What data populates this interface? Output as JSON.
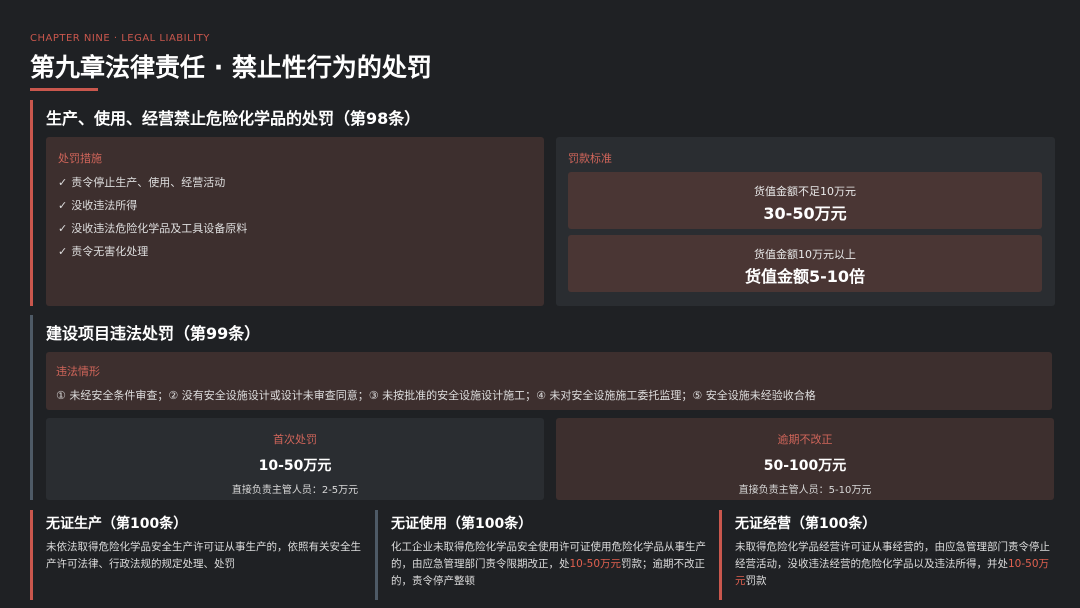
{
  "header": {
    "kicker": "CHAPTER NINE · LEGAL LIABILITY",
    "title": "第九章法律责任 · 禁止性行为的处罚"
  },
  "section1": {
    "heading": "生产、使用、经营禁止危险化学品的处罚（第98条）",
    "measures_label": "处罚措施",
    "measures": [
      "责令停止生产、使用、经营活动",
      "没收违法所得",
      "没收违法危险化学品及工具设备原料",
      "责令无害化处理"
    ],
    "fines_label": "罚款标准",
    "fines": [
      {
        "condition": "货值金额不足10万元",
        "amount": "30-50万元"
      },
      {
        "condition": "货值金额10万元以上",
        "amount": "货值金额5-10倍"
      }
    ]
  },
  "section2": {
    "heading": "建设项目违法处罚（第99条）",
    "violations_label": "违法情形",
    "violations_text": "① 未经安全条件审查；② 没有安全设施设计或设计未审查同意；③ 未按批准的安全设施设计施工；④ 未对安全设施施工委托监理；⑤ 安全设施未经验收合格",
    "first": {
      "label": "首次处罚",
      "amount": "10-50万元",
      "note": "直接负责主管人员：2-5万元"
    },
    "overdue": {
      "label": "逾期不改正",
      "amount": "50-100万元",
      "note": "直接负责主管人员：5-10万元"
    }
  },
  "section3": {
    "production": {
      "heading": "无证生产（第100条）",
      "body": "未依法取得危险化学品安全生产许可证从事生产的，依照有关安全生产许可法律、行政法规的规定处理、处罚"
    },
    "usage": {
      "heading": "无证使用（第100条）",
      "body_pre": "化工企业未取得危险化学品安全使用许可证使用危险化学品从事生产的，由应急管理部门责令限期改正，处",
      "body_hl": "10-50万元",
      "body_post": "罚款；逾期不改正的，责令停产整顿"
    },
    "business": {
      "heading": "无证经营（第100条）",
      "body_pre": "未取得危险化学品经营许可证从事经营的，由应急管理部门责令停止经营活动，没收违法经营的危险化学品以及违法所得，并处",
      "body_hl": "10-50万元",
      "body_post": "罚款"
    }
  },
  "colors": {
    "background": "#1f2124",
    "accent": "#c9574d",
    "panel_warm": "#3d2f2e",
    "panel_cool": "#2a2d31",
    "card_warm": "#4a3634",
    "divider_cool": "#4e5a66"
  }
}
